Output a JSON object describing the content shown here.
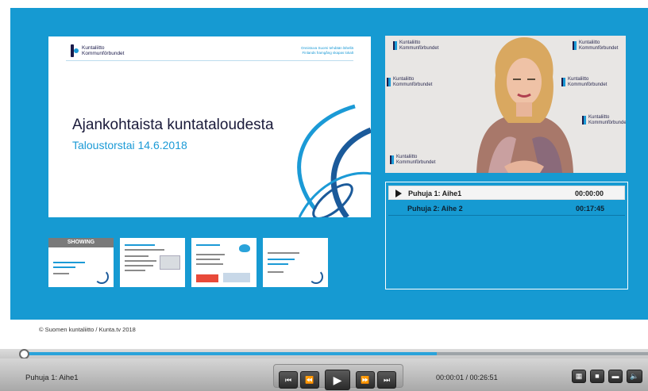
{
  "slide": {
    "logo_line1": "Kuntaliitto",
    "logo_line2": "Kommunförbundet",
    "tagline_line1": "Onnistuva Suomi tehdään lähellä",
    "tagline_line2": "Finlands framgång skapas lokalt",
    "title": "Ajankohtaista kuntataloudesta",
    "subtitle": "Taloustorstai 14.6.2018"
  },
  "video": {
    "watermark_line1": "Kuntaliitto",
    "watermark_line2": "Kommunförbundet"
  },
  "chapters": [
    {
      "label": "Puhuja 1: Aihe1",
      "time": "00:00:00",
      "active": true
    },
    {
      "label": "Puhuja 2: Aihe 2",
      "time": "00:17:45",
      "active": false
    }
  ],
  "thumbnails": {
    "showing_label": "SHOWING",
    "items": [
      {
        "state": "showing"
      },
      {
        "state": "normal"
      },
      {
        "state": "normal"
      },
      {
        "state": "normal"
      }
    ]
  },
  "footer": {
    "copyright": "© Suomen kuntaliitto / Kunta.tv 2018"
  },
  "player": {
    "current_chapter": "Puhuja 1: Aihe1",
    "timecode": "00:00:01 / 00:26:51",
    "progress_percent": 0.06,
    "buttons": {
      "prev_chapter_icon": "⏮",
      "rewind_icon": "⏪",
      "play_icon": "▶",
      "forward_icon": "⏩",
      "next_chapter_icon": "⏭",
      "layout_grid_icon": "▦",
      "layout_slide_icon": "■",
      "layout_split_icon": "▬",
      "volume_icon": "🔈"
    },
    "colors": {
      "stage": "#169ad2",
      "progress": "#2aa3da"
    }
  }
}
